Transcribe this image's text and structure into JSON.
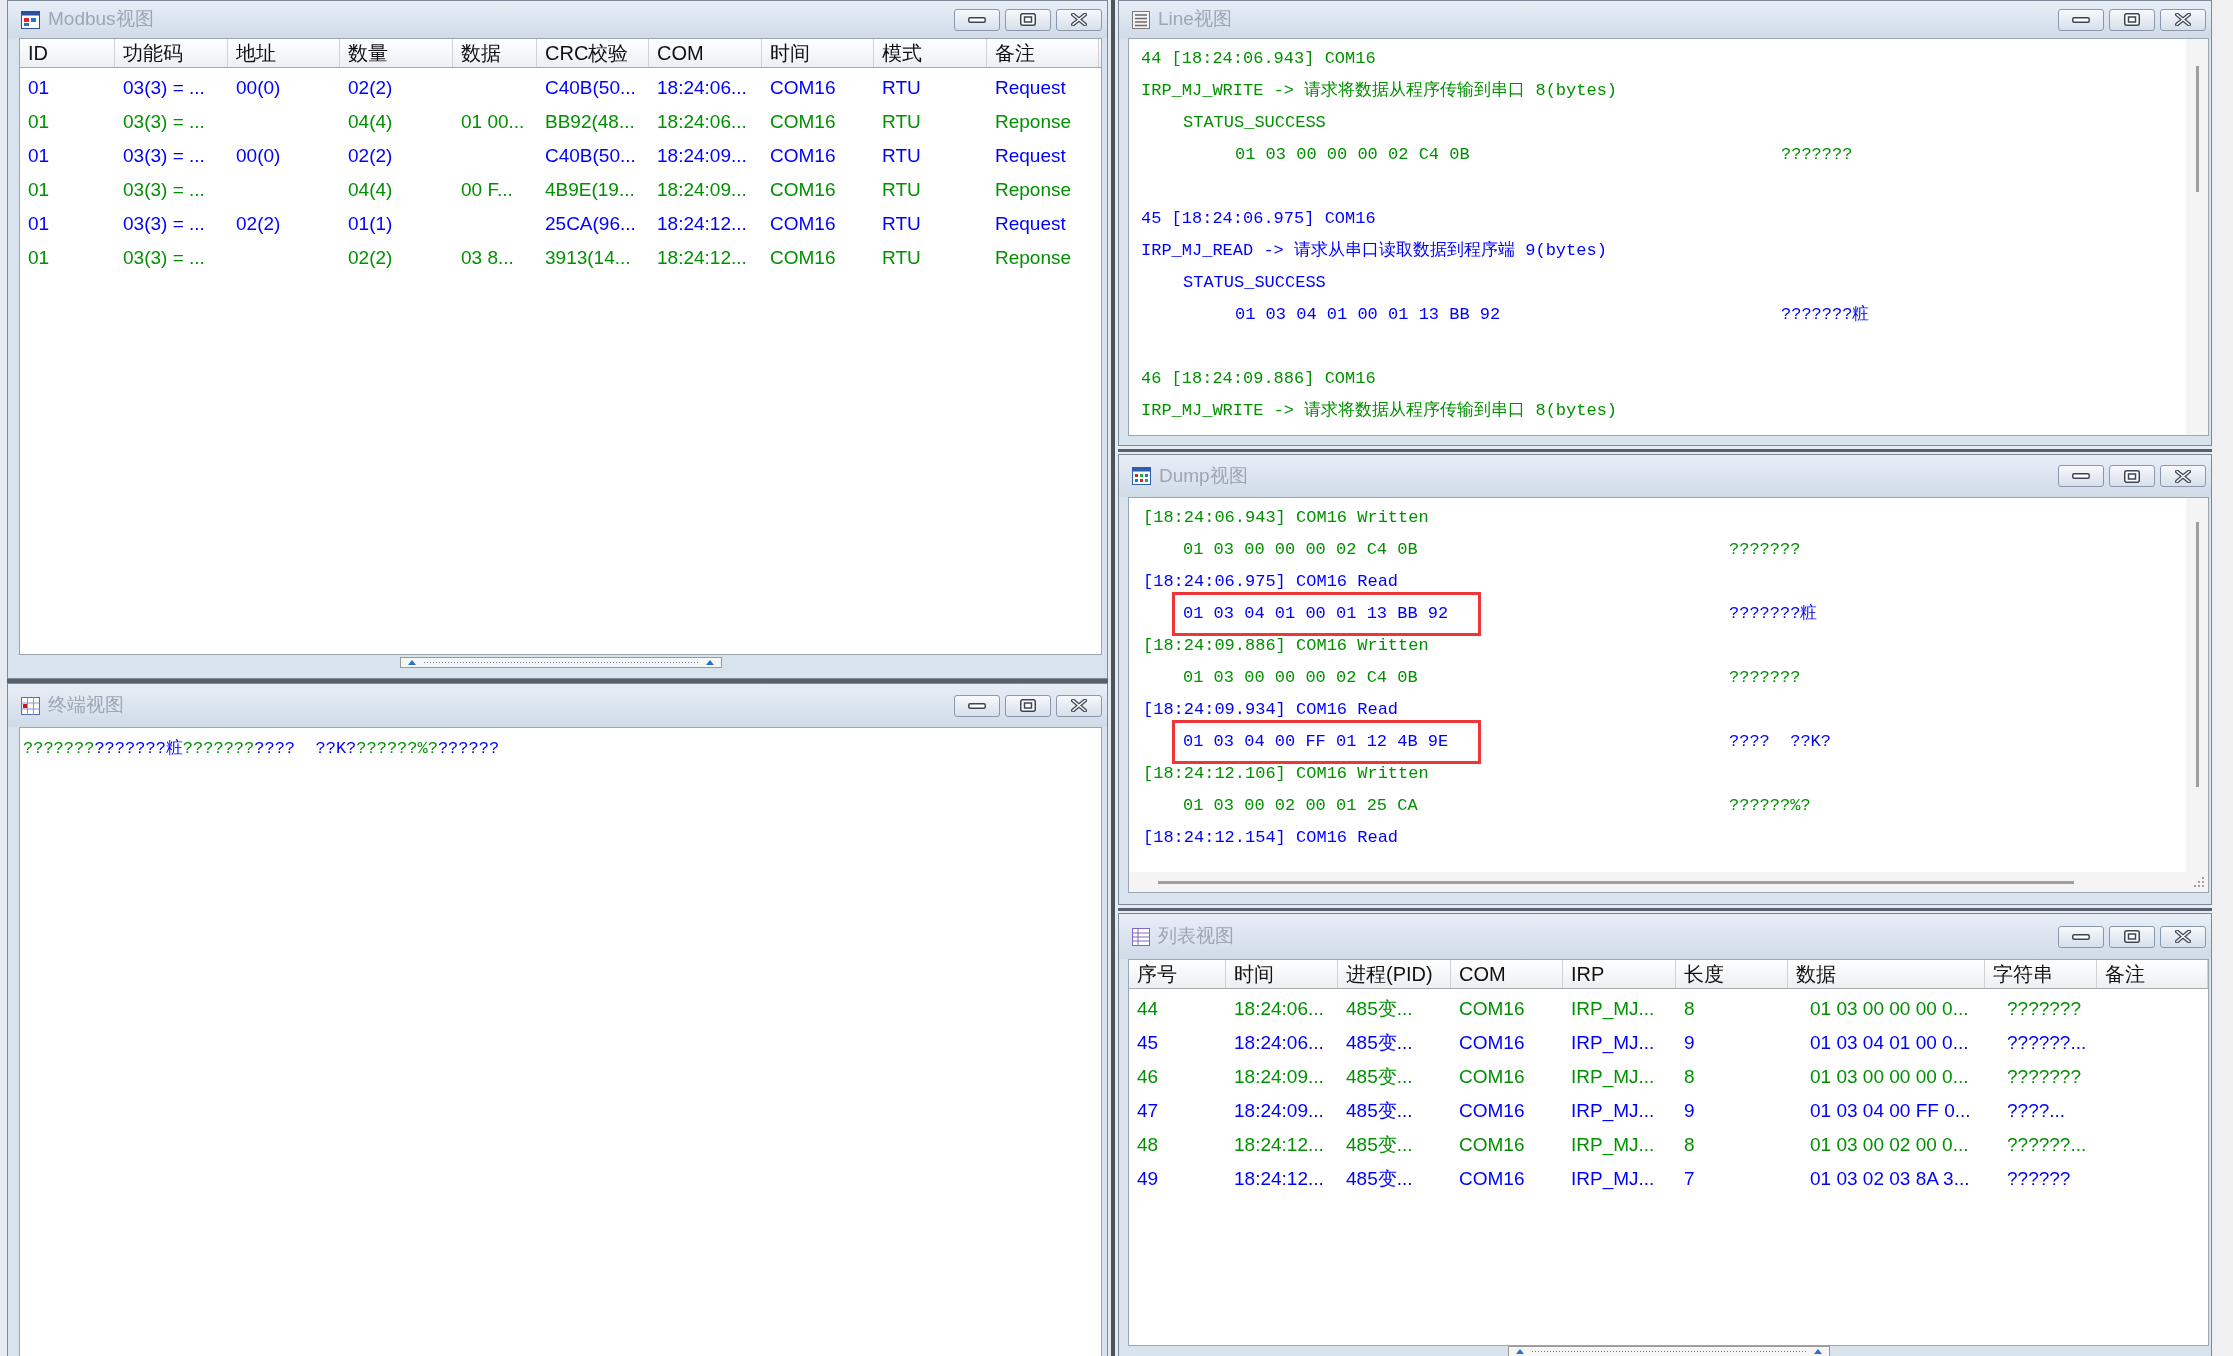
{
  "modbus_view": {
    "title": "Modbus视图",
    "columns": [
      "ID",
      "功能码",
      "地址",
      "数量",
      "数据",
      "CRC校验",
      "COM",
      "时间",
      "模式",
      "备注"
    ],
    "rows": [
      {
        "color": "#0000ff",
        "cells": [
          "01",
          "03(3) = ...",
          "00(0)",
          "02(2)",
          null,
          "C40B(50...",
          "18:24:06...",
          "COM16",
          "RTU",
          "Request"
        ]
      },
      {
        "color": "#009000",
        "cells": [
          "01",
          "03(3) = ...",
          null,
          "04(4)",
          "01 00...",
          "BB92(48...",
          "18:24:06...",
          "COM16",
          "RTU",
          "Reponse"
        ]
      },
      {
        "color": "#0000ff",
        "cells": [
          "01",
          "03(3) = ...",
          "00(0)",
          "02(2)",
          null,
          "C40B(50...",
          "18:24:09...",
          "COM16",
          "RTU",
          "Request"
        ]
      },
      {
        "color": "#009000",
        "cells": [
          "01",
          "03(3) = ...",
          null,
          "04(4)",
          "00 F...",
          "4B9E(19...",
          "18:24:09...",
          "COM16",
          "RTU",
          "Reponse"
        ]
      },
      {
        "color": "#0000ff",
        "cells": [
          "01",
          "03(3) = ...",
          "02(2)",
          "01(1)",
          null,
          "25CA(96...",
          "18:24:12...",
          "COM16",
          "RTU",
          "Request"
        ]
      },
      {
        "color": "#009000",
        "cells": [
          "01",
          "03(3) = ...",
          null,
          "02(2)",
          "03 8...",
          "3913(14...",
          "18:24:12...",
          "COM16",
          "RTU",
          "Reponse"
        ]
      }
    ]
  },
  "terminal_view": {
    "title": "终端视图",
    "segments": [
      {
        "text": "???????",
        "color": "#009000"
      },
      {
        "text": "???????粧",
        "color": "#0000ff"
      },
      {
        "text": "???????",
        "color": "#009000"
      },
      {
        "text": "????  ??K?",
        "color": "#0000ff"
      },
      {
        "text": "??????%?",
        "color": "#009000"
      },
      {
        "text": "??????",
        "color": "#0000ff"
      }
    ]
  },
  "line_view": {
    "title": "Line视图",
    "entries": [
      {
        "color": "#009000",
        "header": "44 [18:24:06.943] COM16",
        "request": "IRP_MJ_WRITE -> 请求将数据从程序传输到串口 8(bytes)",
        "status": "STATUS_SUCCESS",
        "hex": "01 03 00 00 00 02 C4 0B",
        "ascii": "???????"
      },
      {
        "color": "#0000ff",
        "header": "45 [18:24:06.975] COM16",
        "request": "IRP_MJ_READ -> 请求从串口读取数据到程序端 9(bytes)",
        "status": "STATUS_SUCCESS",
        "hex": "01 03 04 01 00 01 13 BB 92",
        "ascii": "???????粧"
      },
      {
        "color": "#009000",
        "header": "46 [18:24:09.886] COM16",
        "request": "IRP_MJ_WRITE -> 请求将数据从程序传输到串口 8(bytes)"
      }
    ]
  },
  "dump_view": {
    "title": "Dump视图",
    "entries": [
      {
        "color": "#009000",
        "header": "[18:24:06.943] COM16 Written",
        "hex": "01 03 00 00 00 02 C4 0B",
        "ascii": "???????",
        "highlighted": false
      },
      {
        "color": "#0000ff",
        "header": "[18:24:06.975] COM16 Read",
        "hex": "01 03 04 01 00 01 13 BB 92",
        "ascii": "???????粧",
        "highlighted": true
      },
      {
        "color": "#009000",
        "header": "[18:24:09.886] COM16 Written",
        "hex": "01 03 00 00 00 02 C4 0B",
        "ascii": "???????",
        "highlighted": false
      },
      {
        "color": "#0000ff",
        "header": "[18:24:09.934] COM16 Read",
        "hex": "01 03 04 00 FF 01 12 4B 9E",
        "ascii": "????  ??K?",
        "highlighted": true
      },
      {
        "color": "#009000",
        "header": "[18:24:12.106] COM16 Written",
        "hex": "01 03 00 02 00 01 25 CA",
        "ascii": "??????%?",
        "highlighted": false
      },
      {
        "color": "#0000ff",
        "header": "[18:24:12.154] COM16 Read"
      }
    ]
  },
  "list_view": {
    "title": "列表视图",
    "columns": [
      "序号",
      "时间",
      "进程(PID)",
      "COM",
      "IRP",
      "长度",
      "数据",
      "字符串",
      "备注"
    ],
    "rows": [
      {
        "color": "#009000",
        "cells": [
          "44",
          "18:24:06...",
          "485变...",
          "COM16",
          "IRP_MJ...",
          "8",
          "01 03 00 00 00 0...",
          "???????"
        ]
      },
      {
        "color": "#0000ff",
        "cells": [
          "45",
          "18:24:06...",
          "485变...",
          "COM16",
          "IRP_MJ...",
          "9",
          "01 03 04 01 00 0...",
          "??????..."
        ]
      },
      {
        "color": "#009000",
        "cells": [
          "46",
          "18:24:09...",
          "485变...",
          "COM16",
          "IRP_MJ...",
          "8",
          "01 03 00 00 00 0...",
          "???????"
        ]
      },
      {
        "color": "#0000ff",
        "cells": [
          "47",
          "18:24:09...",
          "485变...",
          "COM16",
          "IRP_MJ...",
          "9",
          "01 03 04 00 FF 0...",
          "????..."
        ]
      },
      {
        "color": "#009000",
        "cells": [
          "48",
          "18:24:12...",
          "485变...",
          "COM16",
          "IRP_MJ...",
          "8",
          "01 03 00 02 00 0...",
          "??????..."
        ]
      },
      {
        "color": "#0000ff",
        "cells": [
          "49",
          "18:24:12...",
          "485变...",
          "COM16",
          "IRP_MJ...",
          "7",
          "01 03 02 03 8A 3...",
          "??????"
        ]
      }
    ]
  }
}
